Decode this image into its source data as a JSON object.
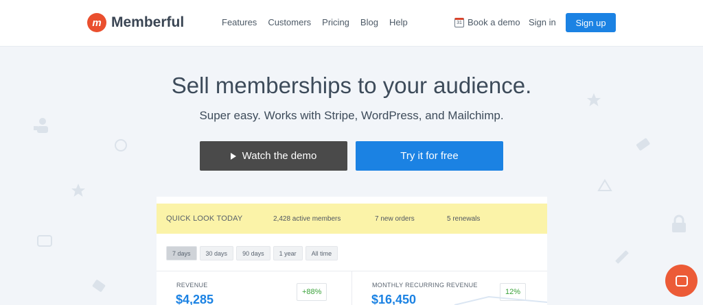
{
  "header": {
    "logo_mark": "m",
    "logo_text": "Memberful",
    "nav": [
      "Features",
      "Customers",
      "Pricing",
      "Blog",
      "Help"
    ],
    "calendar_day": "31",
    "book_demo": "Book a demo",
    "sign_in": "Sign in",
    "sign_up": "Sign up"
  },
  "hero": {
    "headline": "Sell memberships to your audience.",
    "subline": "Super easy. Works with Stripe, WordPress, and Mailchimp.",
    "watch_demo": "Watch the demo",
    "try_free": "Try it for free"
  },
  "dashboard": {
    "quick_title": "QUICK LOOK TODAY",
    "active_members": "2,428 active members",
    "new_orders": "7 new orders",
    "renewals": "5 renewals",
    "ranges": [
      "7 days",
      "30 days",
      "90 days",
      "1 year",
      "All time"
    ],
    "active_range": "7 days",
    "revenue_label": "REVENUE",
    "revenue_value": "$4,285",
    "revenue_change": "+88%",
    "mrr_label": "MONTHLY RECURRING REVENUE",
    "mrr_value": "$16,450",
    "mrr_change": "12%"
  },
  "colors": {
    "brand_orange": "#ea4f2e",
    "primary_blue": "#1b82e3",
    "dark_button": "#4a4a4a",
    "highlight_yellow": "#fbf3a8"
  },
  "icons": [
    "calendar-icon",
    "play-icon",
    "chat-icon",
    "star-icon",
    "lock-icon",
    "tag-icon",
    "pencil-icon",
    "user-icon"
  ]
}
